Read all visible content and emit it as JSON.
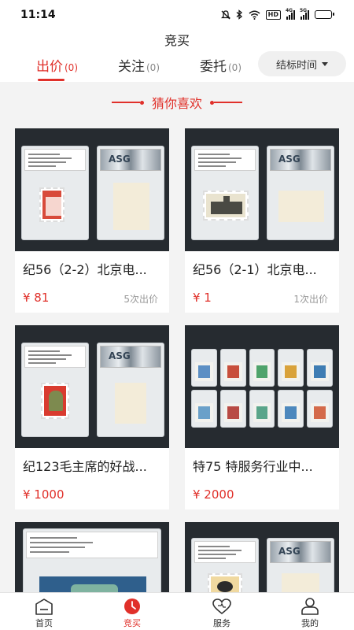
{
  "status": {
    "time": "11:14",
    "net_hd": "HD",
    "sig1": "4G",
    "sig2": "5G",
    "battery_level": 0.25
  },
  "page": {
    "title": "竞买"
  },
  "tabs": [
    {
      "label": "出价",
      "count": "(0)",
      "active": true
    },
    {
      "label": "关注",
      "count": "(0)",
      "active": false
    },
    {
      "label": "委托",
      "count": "(0)",
      "active": false
    }
  ],
  "sort": {
    "label": "结标时间"
  },
  "section": {
    "title": "猜你喜欢"
  },
  "items": [
    {
      "name": "纪56（2-2）北京电...",
      "price": "¥ 81",
      "bids": "5次出价",
      "slab_grade": "ASG"
    },
    {
      "name": "纪56（2-1）北京电...",
      "price": "¥ 1",
      "bids": "1次出价",
      "slab_grade": "ASG"
    },
    {
      "name": "纪123毛主席的好战...",
      "price": "¥ 1000",
      "bids": "",
      "slab_grade": "ASG"
    },
    {
      "name": "特75 特服务行业中...",
      "price": "¥ 2000",
      "bids": "",
      "slab_grade": ""
    },
    {
      "name": "",
      "price": "",
      "bids": "",
      "slab_grade": ""
    },
    {
      "name": "",
      "price": "",
      "bids": "",
      "slab_grade": "ASG"
    }
  ],
  "nav": [
    {
      "label": "首页",
      "icon": "home-icon",
      "active": false
    },
    {
      "label": "竞买",
      "icon": "auction-clock-icon",
      "active": true
    },
    {
      "label": "服务",
      "icon": "heart-icon",
      "active": false
    },
    {
      "label": "我的",
      "icon": "profile-icon",
      "active": false
    }
  ],
  "colors": {
    "accent": "#e0302a",
    "image_bg": "#262b30",
    "page_bg": "#f3f3f3"
  }
}
